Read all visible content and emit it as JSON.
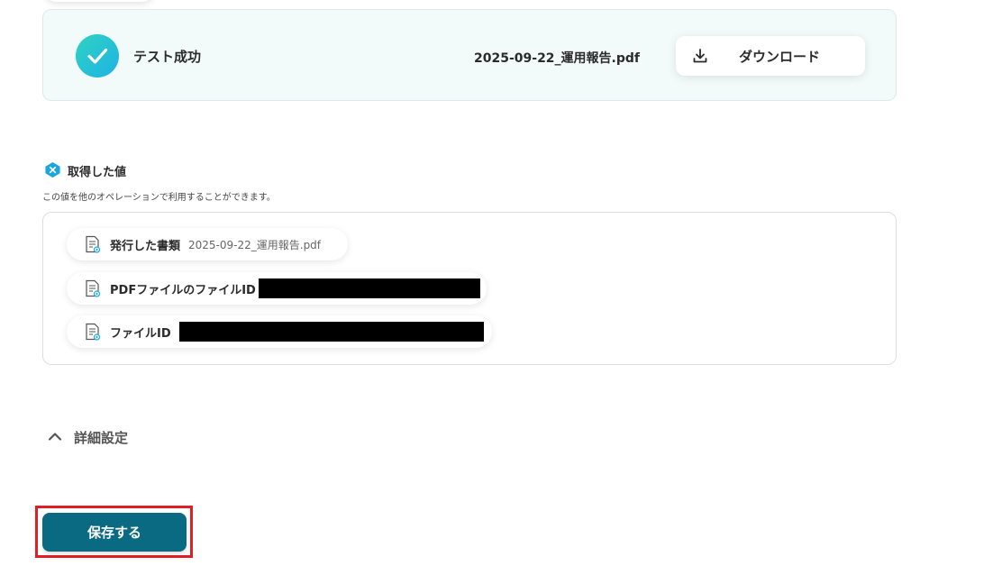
{
  "test_result": {
    "status_label": "テスト成功",
    "file_name": "2025-09-22_運用報告.pdf",
    "download_label": "ダウンロード"
  },
  "acquired_values": {
    "title": "取得した値",
    "description": "この値を他のオペレーションで利用することができます。",
    "items": [
      {
        "label": "発行した書類",
        "value": "2025-09-22_運用報告.pdf"
      },
      {
        "label": "PDFファイルのファイルID",
        "value": "[redacted]"
      },
      {
        "label": "ファイルID",
        "value": "[redacted]"
      }
    ]
  },
  "advanced_settings": {
    "label": "詳細設定"
  },
  "save_button": {
    "label": "保存する"
  },
  "colors": {
    "primary": "#0a6a82",
    "highlight": "#e01f24",
    "success_gradient_start": "#2fd3c0",
    "success_gradient_end": "#1fb2e6",
    "card_background": "#f3fafa"
  },
  "icons": {
    "success": "check-circle-icon",
    "download": "download-icon",
    "badge": "variable-x-icon",
    "document": "document-icon",
    "chevron": "chevron-up-icon"
  }
}
